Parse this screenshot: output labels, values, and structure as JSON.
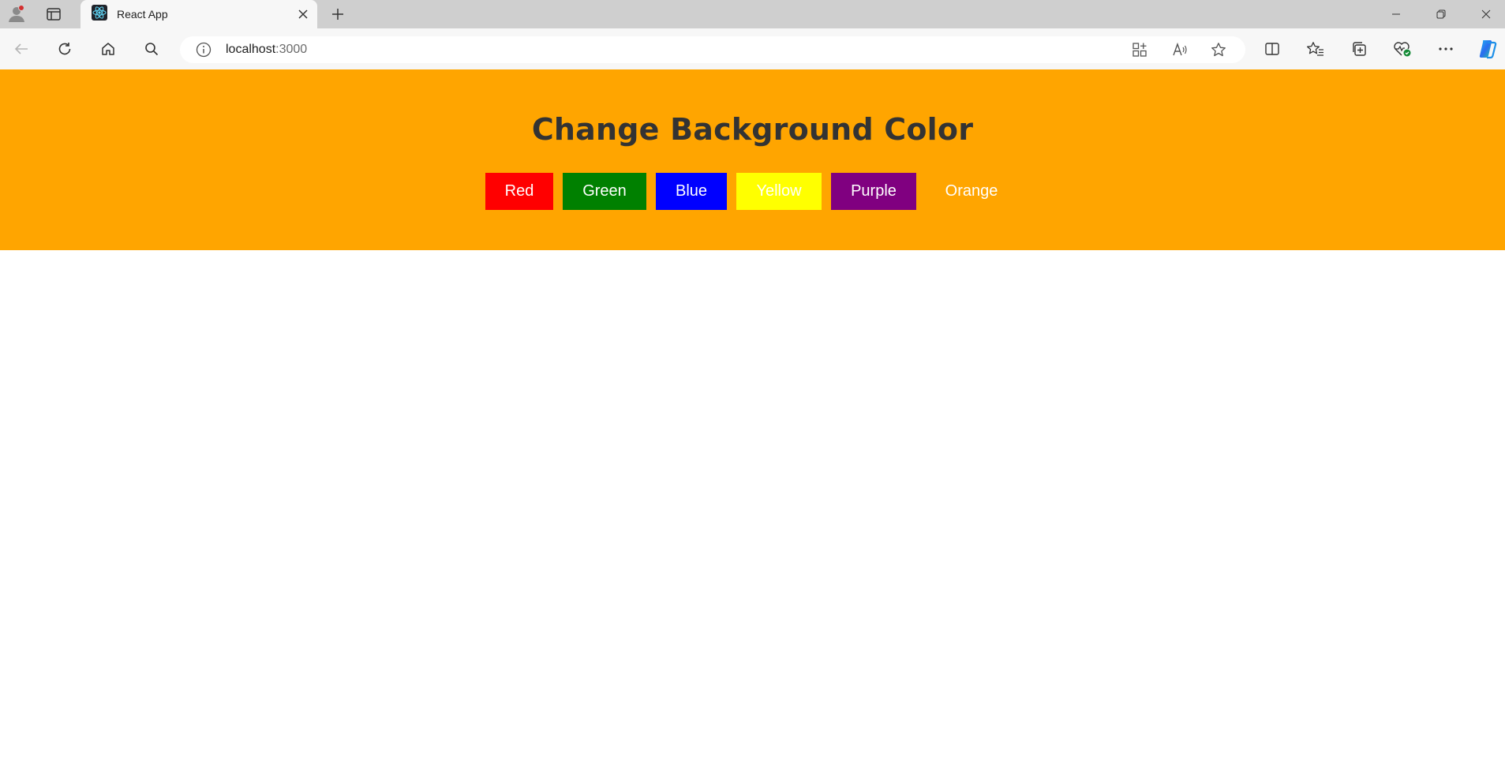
{
  "browser": {
    "tab_title": "React App",
    "url_host": "localhost",
    "url_port": ":3000",
    "icons": {
      "profile": "profile-icon",
      "tab_actions": "tab-actions-icon",
      "tab_favicon": "react-logo-icon",
      "tab_close": "close-icon",
      "new_tab": "plus-icon",
      "minimize": "minimize-icon",
      "restore": "restore-icon",
      "close_window": "close-icon",
      "back": "back-arrow-icon",
      "refresh": "refresh-icon",
      "home": "home-icon",
      "search": "search-icon",
      "site_info": "info-icon",
      "app_available": "apps-icon",
      "read_aloud": "read-aloud-icon",
      "favorite": "star-icon",
      "split_screen": "split-screen-icon",
      "favorites": "favorites-icon",
      "collections": "collections-icon",
      "browser_essentials": "heart-pulse-icon",
      "more": "more-icon",
      "copilot": "copilot-icon"
    }
  },
  "app": {
    "heading": "Change Background Color",
    "background": "#ffa500",
    "buttons": [
      {
        "label": "Red",
        "color": "#ff0000"
      },
      {
        "label": "Green",
        "color": "#008000"
      },
      {
        "label": "Blue",
        "color": "#0000ff"
      },
      {
        "label": "Yellow",
        "color": "#ffff00"
      },
      {
        "label": "Purple",
        "color": "#800080"
      },
      {
        "label": "Orange",
        "color": "#ffa500"
      }
    ]
  }
}
